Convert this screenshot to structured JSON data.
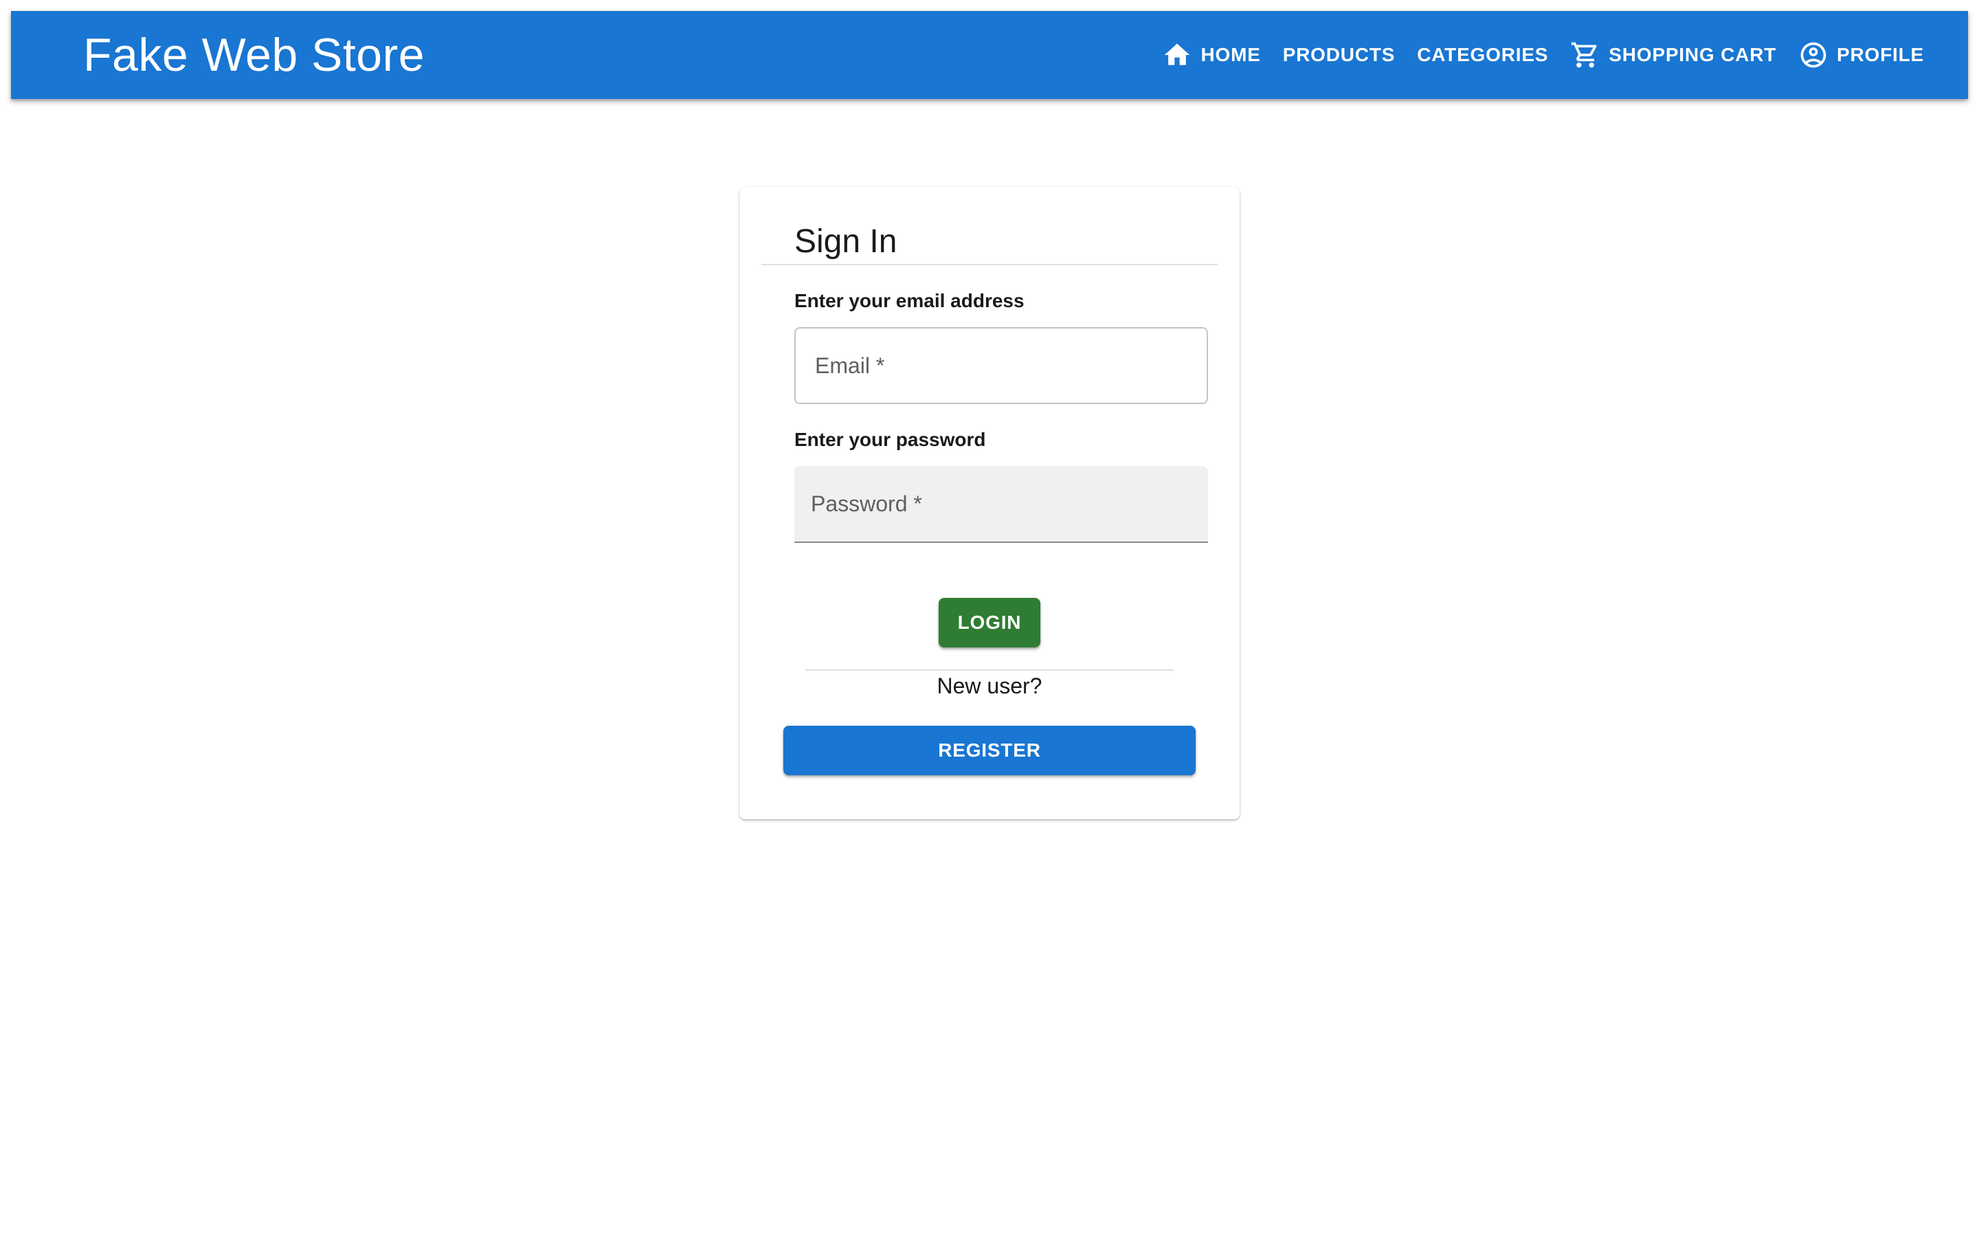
{
  "app": {
    "brand": "Fake Web Store",
    "primary_color": "#1976d2"
  },
  "nav": {
    "items": [
      {
        "label": "HOME",
        "icon": "home-icon"
      },
      {
        "label": "PRODUCTS",
        "icon": null
      },
      {
        "label": "CATEGORIES",
        "icon": null
      },
      {
        "label": "SHOPPING CART",
        "icon": "shopping-cart-icon"
      },
      {
        "label": "PROFILE",
        "icon": "account-circle-icon"
      }
    ]
  },
  "signin": {
    "title": "Sign In",
    "email_label": "Enter your email address",
    "email_placeholder": "Email *",
    "email_value": "",
    "password_label": "Enter your password",
    "password_placeholder": "Password *",
    "password_value": "",
    "login_label": "LOGIN",
    "login_color": "#2e7d32",
    "new_user_text": "New user?",
    "register_label": "REGISTER",
    "register_color": "#1976d2"
  }
}
